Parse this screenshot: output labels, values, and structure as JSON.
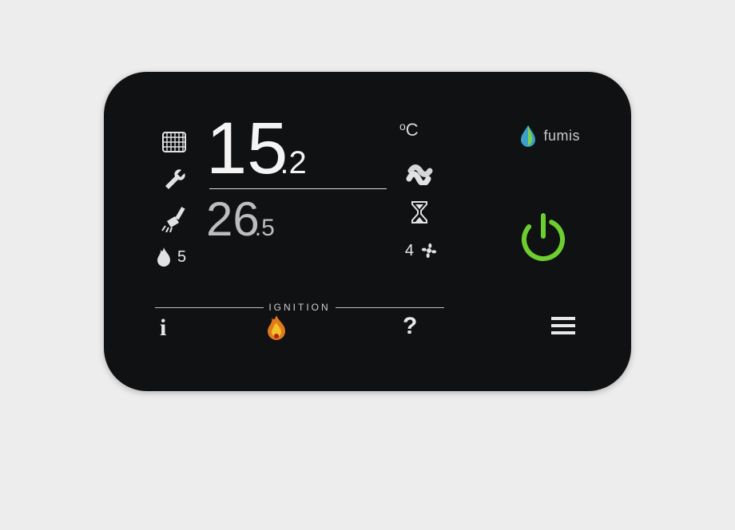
{
  "brand": {
    "name": "fumis"
  },
  "unit": {
    "symbol": "C",
    "degree": "o"
  },
  "temps": {
    "set_whole": "15",
    "set_frac": ".2",
    "room_whole": "26",
    "room_frac": ".5"
  },
  "left": {
    "flame_level": "5"
  },
  "mid": {
    "fan_level": "4"
  },
  "status": {
    "label": "IGNITION"
  },
  "bottom": {
    "info": "i",
    "help": "?"
  },
  "icons": {
    "grate": "grate-icon",
    "wrench": "wrench-icon",
    "brush": "brush-icon",
    "flame_small": "flame-icon",
    "wave": "wave-icon",
    "hourglass": "hourglass-icon",
    "fan": "fan-icon",
    "droplet": "droplet-icon",
    "power": "power-icon",
    "flame_color": "flame-color-icon",
    "menu": "menu-icon"
  }
}
